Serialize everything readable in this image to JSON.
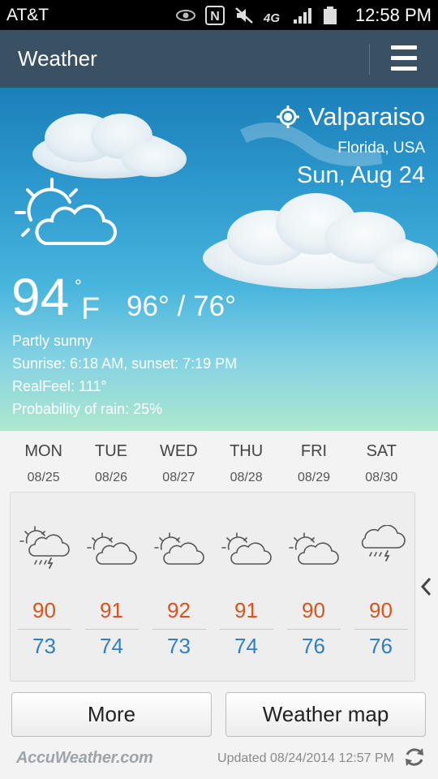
{
  "status_bar": {
    "carrier": "AT&T",
    "time": "12:58 PM",
    "icons": [
      "eye-icon",
      "nfc-icon",
      "mute-icon",
      "4g-icon",
      "signal-icon",
      "battery-icon"
    ]
  },
  "app_bar": {
    "title": "Weather",
    "menu_icon": "hamburger-menu-icon"
  },
  "location": {
    "city": "Valparaiso",
    "region": "Florida, USA",
    "date": "Sun, Aug 24"
  },
  "current": {
    "temp": "94",
    "degree": "°",
    "unit": "F",
    "high_low": "96° / 76°",
    "condition": "Partly sunny",
    "sun": "Sunrise: 6:18  AM, sunset: 7:19  PM",
    "realfeel": "RealFeel: 111°",
    "rain": "Probability of rain: 25%",
    "icon": "partly-sunny-icon"
  },
  "forecast": [
    {
      "day": "MON",
      "date": "08/25",
      "high": "90",
      "low": "73",
      "icon": "sun-cloud-thunderstorm-icon"
    },
    {
      "day": "TUE",
      "date": "08/26",
      "high": "91",
      "low": "74",
      "icon": "partly-sunny-icon"
    },
    {
      "day": "WED",
      "date": "08/27",
      "high": "92",
      "low": "73",
      "icon": "partly-sunny-icon"
    },
    {
      "day": "THU",
      "date": "08/28",
      "high": "91",
      "low": "74",
      "icon": "partly-sunny-icon"
    },
    {
      "day": "FRI",
      "date": "08/29",
      "high": "90",
      "low": "76",
      "icon": "partly-sunny-icon"
    },
    {
      "day": "SAT",
      "date": "08/30",
      "high": "90",
      "low": "76",
      "icon": "thunderstorm-icon"
    }
  ],
  "buttons": {
    "more": "More",
    "map": "Weather map"
  },
  "footer": {
    "brand": "AccuWeather.com",
    "updated": "Updated 08/24/2014 12:57 PM"
  },
  "colors": {
    "app_bar": "#3a5164",
    "high_temp": "#d9531e",
    "low_temp": "#2f7fc4"
  }
}
